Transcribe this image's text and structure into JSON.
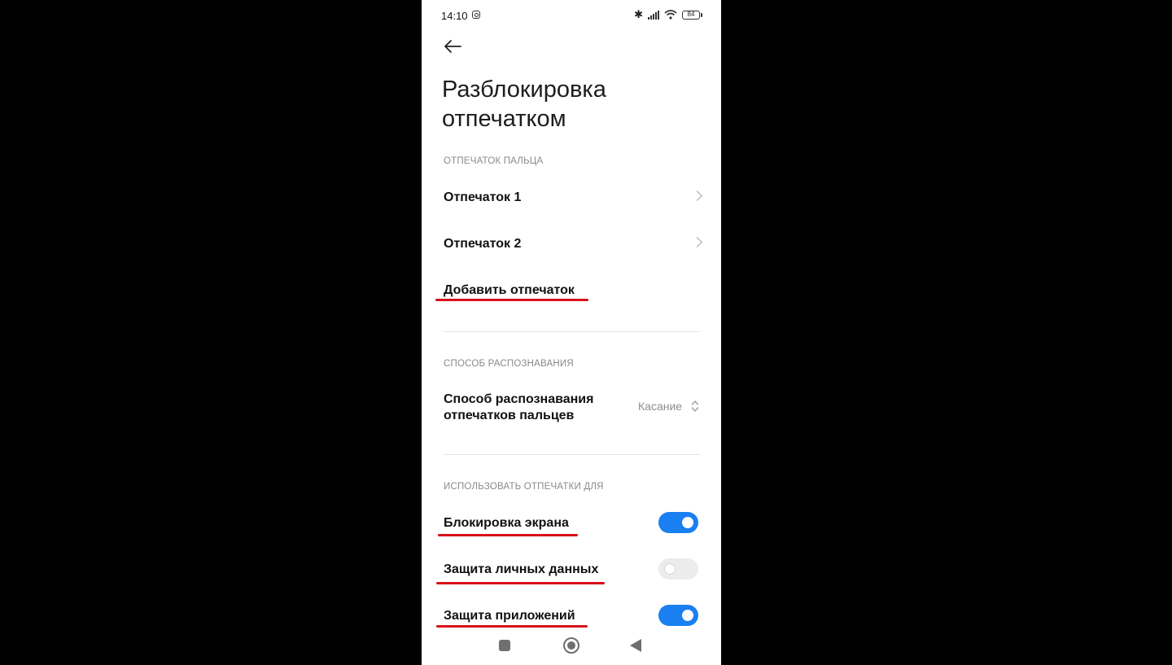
{
  "status_bar": {
    "time": "14:10",
    "battery": "84",
    "icons": [
      "instagram-icon",
      "bluetooth-icon",
      "signal-icon",
      "wifi-icon",
      "battery-icon"
    ]
  },
  "header": {
    "back_icon": "arrow-left-icon",
    "title": "Разблокировка отпечатком"
  },
  "fingerprints": {
    "section_title": "ОТПЕЧАТОК ПАЛЬЦА",
    "items": [
      {
        "label": "Отпечаток 1"
      },
      {
        "label": "Отпечаток 2"
      }
    ],
    "add_label": "Добавить отпечаток"
  },
  "recognition": {
    "section_title": "СПОСОБ РАСПОЗНАВАНИЯ",
    "label": "Способ распознавания отпечатков пальцев",
    "value": "Касание"
  },
  "usage": {
    "section_title": "ИСПОЛЬЗОВАТЬ ОТПЕЧАТКИ ДЛЯ",
    "items": [
      {
        "label": "Блокировка экрана",
        "enabled": true
      },
      {
        "label": "Защита личных данных",
        "enabled": false
      },
      {
        "label": "Защита приложений",
        "enabled": true
      }
    ]
  },
  "colors": {
    "accent": "#1a7ff0",
    "annotation_underline": "#d8101a",
    "background": "#ffffff",
    "outer_background": "#000000"
  },
  "nav_bar": {
    "icons": [
      "recents-square-icon",
      "home-circle-icon",
      "back-triangle-icon"
    ]
  }
}
